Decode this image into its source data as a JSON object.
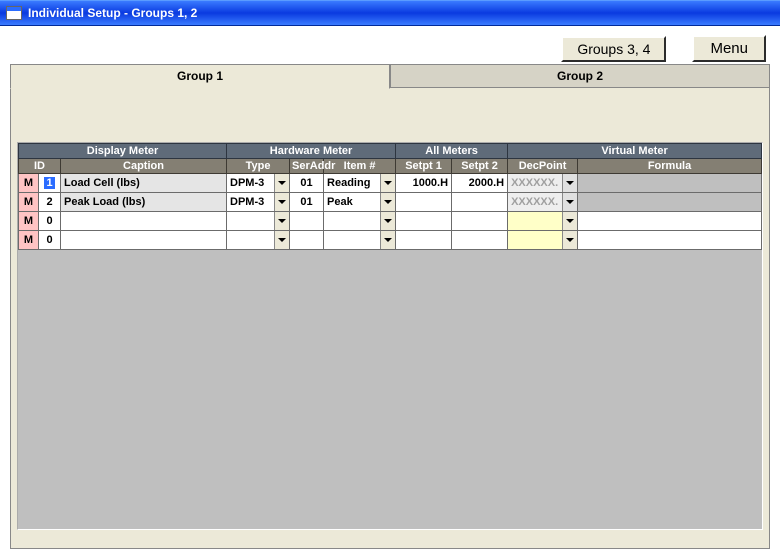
{
  "window": {
    "title": "Individual Setup - Groups 1, 2"
  },
  "buttons": {
    "groups34": "Groups 3, 4",
    "menu": "Menu"
  },
  "tabs": {
    "group1": "Group 1",
    "group2": "Group 2"
  },
  "headers": {
    "display_meter": "Display Meter",
    "hardware_meter": "Hardware Meter",
    "all_meters": "All Meters",
    "virtual_meter": "Virtual Meter",
    "id": "ID",
    "caption": "Caption",
    "type": "Type",
    "seraddr": "SerAddr",
    "itemnum": "Item #",
    "setpt1": "Setpt 1",
    "setpt2": "Setpt 2",
    "decpoint": "DecPoint",
    "formula": "Formula"
  },
  "rows": [
    {
      "m": "M",
      "id": "1",
      "id_selected": true,
      "caption": "Load Cell (lbs)",
      "caption_grey": true,
      "type": "DPM-3",
      "seraddr": "01",
      "item": "Reading",
      "setpt1": "1000.H",
      "setpt2": "2000.H",
      "decpoint": "XXXXXX.",
      "decpoint_disabled": true,
      "formula_bg_grey": true
    },
    {
      "m": "M",
      "id": "2",
      "id_selected": false,
      "caption": "Peak Load (lbs)",
      "caption_grey": true,
      "type": "DPM-3",
      "seraddr": "01",
      "item": "Peak",
      "setpt1": "",
      "setpt2": "",
      "decpoint": "XXXXXX.",
      "decpoint_disabled": true,
      "formula_bg_grey": true
    },
    {
      "m": "M",
      "id": "0",
      "id_selected": false,
      "caption": "",
      "caption_grey": false,
      "type": "",
      "seraddr": "",
      "item": "",
      "setpt1": "",
      "setpt2": "",
      "decpoint": "",
      "decpoint_disabled": false,
      "decpoint_yellow": true,
      "formula_bg_grey": false
    },
    {
      "m": "M",
      "id": "0",
      "id_selected": false,
      "caption": "",
      "caption_grey": false,
      "type": "",
      "seraddr": "",
      "item": "",
      "setpt1": "",
      "setpt2": "",
      "decpoint": "",
      "decpoint_disabled": false,
      "decpoint_yellow": true,
      "formula_bg_grey": false
    }
  ]
}
